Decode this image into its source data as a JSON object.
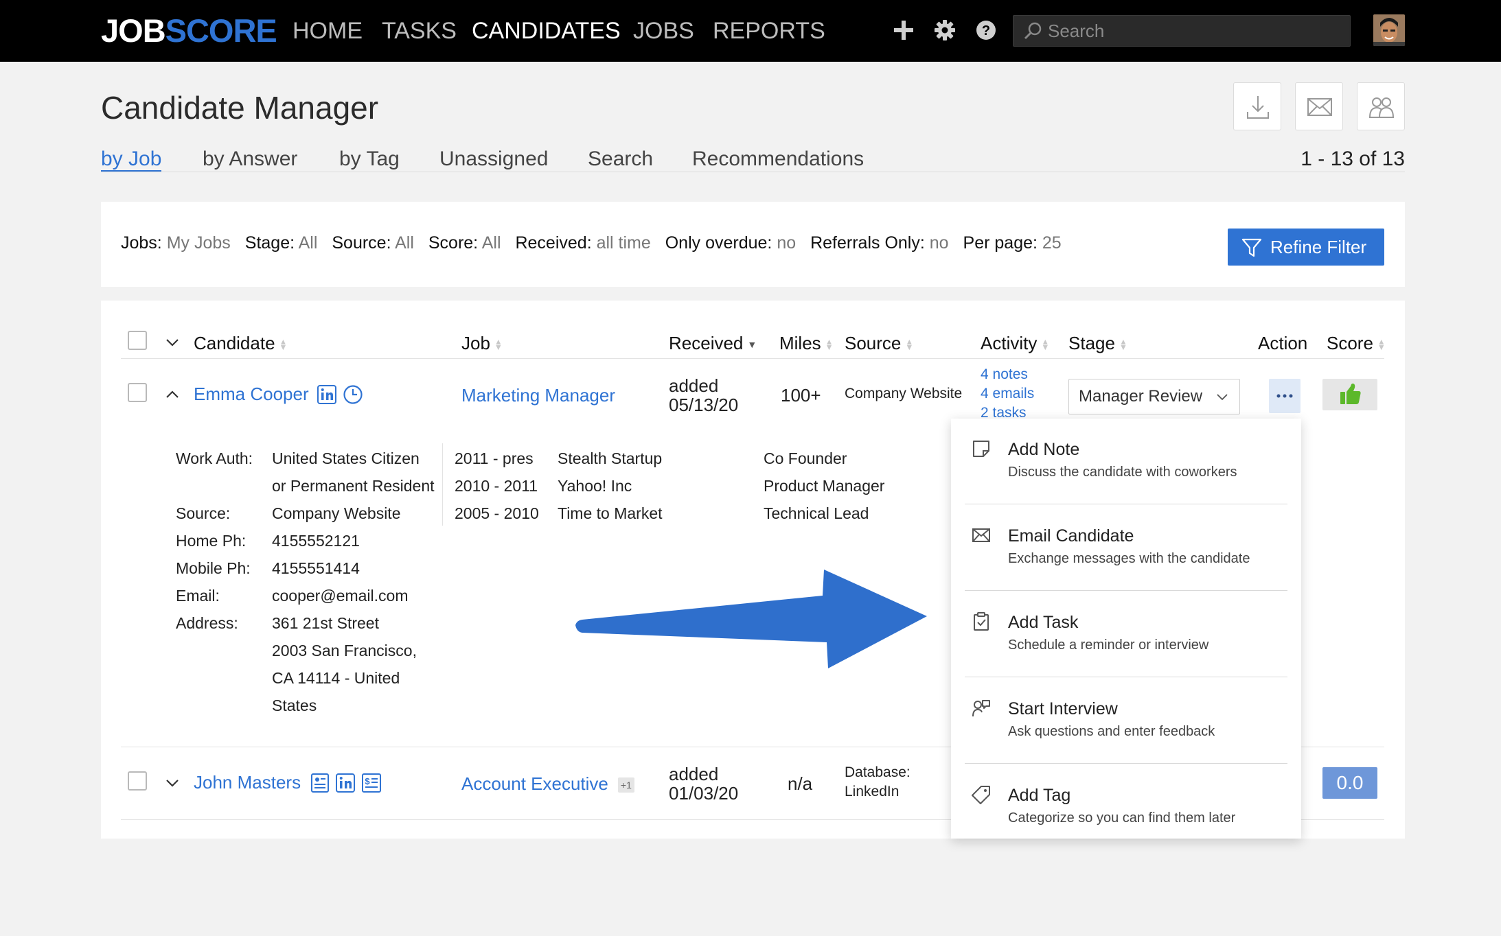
{
  "brand": {
    "part1": "JOB",
    "part2": "SCORE"
  },
  "nav": {
    "items": [
      "HOME",
      "TASKS",
      "CANDIDATES",
      "JOBS",
      "REPORTS"
    ],
    "active": "CANDIDATES",
    "icons": [
      "plus-icon",
      "gear-icon",
      "help-icon"
    ],
    "search_placeholder": "Search"
  },
  "page": {
    "title": "Candidate Manager",
    "tabs": [
      "by Job",
      "by Answer",
      "by Tag",
      "Unassigned",
      "Search",
      "Recommendations"
    ],
    "active_tab": "by Job",
    "count": "1 - 13 of 13",
    "tools": [
      "download-icon",
      "email-icon",
      "group-icon"
    ]
  },
  "filters": {
    "items": [
      {
        "label": "Jobs:",
        "value": "My Jobs"
      },
      {
        "label": "Stage:",
        "value": "All"
      },
      {
        "label": "Source:",
        "value": "All"
      },
      {
        "label": "Score:",
        "value": "All"
      },
      {
        "label": "Received:",
        "value": "all time"
      },
      {
        "label": "Only overdue:",
        "value": "no"
      },
      {
        "label": "Referrals Only:",
        "value": "no"
      },
      {
        "label": "Per page:",
        "value": "25"
      }
    ],
    "refine_label": "Refine Filter"
  },
  "table": {
    "headers": {
      "candidate": "Candidate",
      "job": "Job",
      "received": "Received",
      "miles": "Miles",
      "source": "Source",
      "activity": "Activity",
      "stage": "Stage",
      "action": "Action",
      "score": "Score"
    },
    "rows": [
      {
        "name": "Emma Cooper",
        "job": "Marketing Manager",
        "received_1": "added",
        "received_2": "05/13/20",
        "miles": "100+",
        "source": "Company Website",
        "activity": [
          "4 notes",
          "4 emails",
          "2 tasks"
        ],
        "stage": "Manager Review",
        "details": {
          "labels": [
            "Work Auth:",
            "Source:",
            "Home Ph:",
            "Mobile Ph:",
            "Email:",
            "Address:"
          ],
          "work_auth_1": "United States Citizen",
          "work_auth_2": "or Permanent Resident",
          "source": "Company Website",
          "home_ph": "4155552121",
          "mobile_ph": "4155551414",
          "email": "cooper@email.com",
          "address": [
            "361 21st Street",
            "2003 San Francisco,",
            "CA 14114 - United",
            "States"
          ],
          "history": [
            {
              "years": "2011 - pres",
              "company": "Stealth Startup",
              "title": "Co Founder"
            },
            {
              "years": "2010 - 2011",
              "company": "Yahoo! Inc",
              "title": "Product Manager"
            },
            {
              "years": "2005 - 2010",
              "company": "Time to Market",
              "title": "Technical Lead"
            }
          ]
        }
      },
      {
        "name": "John Masters",
        "job": "Account Executive",
        "job_extra": "+1",
        "received_1": "added",
        "received_2": "01/03/20",
        "miles": "n/a",
        "source_1": "Database:",
        "source_2": "LinkedIn",
        "score": "0.0"
      }
    ]
  },
  "action_menu": [
    {
      "title": "Add Note",
      "subtitle": "Discuss the candidate with coworkers",
      "icon": "note-icon"
    },
    {
      "title": "Email Candidate",
      "subtitle": "Exchange messages with the candidate",
      "icon": "envelope-icon"
    },
    {
      "title": "Add Task",
      "subtitle": "Schedule a reminder or interview",
      "icon": "clipboard-icon"
    },
    {
      "title": "Start Interview",
      "subtitle": "Ask questions and enter feedback",
      "icon": "interview-icon"
    },
    {
      "title": "Add Tag",
      "subtitle": "Categorize so you can find them later",
      "icon": "tag-icon"
    }
  ],
  "colors": {
    "accent": "#2f73d3",
    "nav_bg": "#000000",
    "thumb": "#5cb82a",
    "score_badge": "#6e97d9"
  }
}
